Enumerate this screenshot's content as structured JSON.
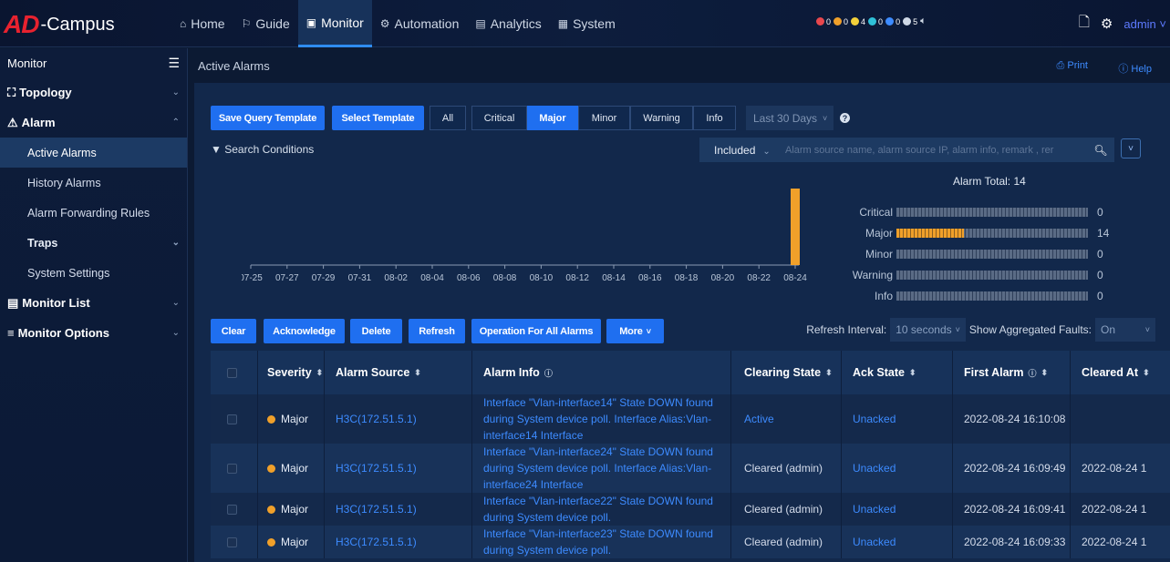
{
  "brand": {
    "logo_mark": "AD",
    "logo_text": "-Campus"
  },
  "nav": [
    {
      "label": "Home",
      "icon": "home-icon"
    },
    {
      "label": "Guide",
      "icon": "guide-icon"
    },
    {
      "label": "Monitor",
      "icon": "monitor-icon",
      "active": true
    },
    {
      "label": "Automation",
      "icon": "automation-icon"
    },
    {
      "label": "Analytics",
      "icon": "analytics-icon"
    },
    {
      "label": "System",
      "icon": "system-icon"
    }
  ],
  "alarm_counts": [
    {
      "value": "0",
      "color": "#e8474d"
    },
    {
      "value": "0",
      "color": "#f0a02a"
    },
    {
      "value": "4",
      "color": "#f3d03a"
    },
    {
      "value": "0",
      "color": "#2fc1d8"
    },
    {
      "value": "0",
      "color": "#3d8bff"
    },
    {
      "value": "5",
      "color": "#cfd8e6"
    }
  ],
  "user": {
    "name": "admin"
  },
  "sidebar": {
    "title": "Monitor",
    "topology": "Topology",
    "alarm": "Alarm",
    "active_alarms": "Active Alarms",
    "history_alarms": "History Alarms",
    "alarm_forwarding": "Alarm Forwarding Rules",
    "traps": "Traps",
    "system_settings": "System Settings",
    "monitor_list": "Monitor List",
    "monitor_options": "Monitor Options"
  },
  "page": {
    "breadcrumb": "Active Alarms",
    "print": "Print",
    "help": "Help"
  },
  "toolbar": {
    "save_query_template": "Save Query Template",
    "select_template": "Select Template",
    "filters": [
      "All",
      "Critical",
      "Major",
      "Minor",
      "Warning",
      "Info"
    ],
    "selected_filter": "Major",
    "date_range": "Last 30 Days"
  },
  "search": {
    "conditions_label": "Search Conditions",
    "scope": "Included",
    "placeholder": "Alarm source name, alarm source IP, alarm info, remark , rer"
  },
  "chart_data": {
    "type": "bar",
    "categories": [
      "07-25",
      "07-27",
      "07-29",
      "07-31",
      "08-02",
      "08-04",
      "08-06",
      "08-08",
      "08-10",
      "08-12",
      "08-14",
      "08-16",
      "08-18",
      "08-20",
      "08-22",
      "08-24"
    ],
    "values": [
      0,
      0,
      0,
      0,
      0,
      0,
      0,
      0,
      0,
      0,
      0,
      0,
      0,
      0,
      0,
      14
    ],
    "bar_color": "#f0a02a"
  },
  "summary": {
    "total_label": "Alarm Total:",
    "total": "14",
    "rows": [
      {
        "label": "Critical",
        "value": "0",
        "fraction": 0
      },
      {
        "label": "Major",
        "value": "14",
        "fraction": 0.35
      },
      {
        "label": "Minor",
        "value": "0",
        "fraction": 0
      },
      {
        "label": "Warning",
        "value": "0",
        "fraction": 0
      },
      {
        "label": "Info",
        "value": "0",
        "fraction": 0
      }
    ]
  },
  "actions": {
    "clear": "Clear",
    "acknowledge": "Acknowledge",
    "delete": "Delete",
    "refresh": "Refresh",
    "operation_all": "Operation For All Alarms",
    "more": "More"
  },
  "refresh": {
    "interval_label": "Refresh Interval:",
    "interval_value": "10 seconds",
    "aggregated_label": "Show Aggregated Faults:",
    "aggregated_value": "On"
  },
  "table": {
    "headers": [
      "Severity",
      "Alarm Source",
      "Alarm Info",
      "Clearing State",
      "Ack State",
      "First Alarm",
      "Cleared At"
    ],
    "rows": [
      {
        "severity": "Major",
        "source": "H3C(172.51.5.1)",
        "info": "Interface \"Vlan-interface14\" State DOWN found during System device poll. Interface Alias:Vlan-interface14 Interface",
        "clearing": "Active",
        "ack": "Unacked",
        "first": "2022-08-24 16:10:08",
        "cleared": ""
      },
      {
        "severity": "Major",
        "source": "H3C(172.51.5.1)",
        "info": "Interface \"Vlan-interface24\" State DOWN found during System device poll. Interface Alias:Vlan-interface24 Interface",
        "clearing": "Cleared (admin)",
        "ack": "Unacked",
        "first": "2022-08-24 16:09:49",
        "cleared": "2022-08-24 1"
      },
      {
        "severity": "Major",
        "source": "H3C(172.51.5.1)",
        "info": "Interface \"Vlan-interface22\" State DOWN found during System device poll.",
        "clearing": "Cleared (admin)",
        "ack": "Unacked",
        "first": "2022-08-24 16:09:41",
        "cleared": "2022-08-24 1"
      },
      {
        "severity": "Major",
        "source": "H3C(172.51.5.1)",
        "info": "Interface \"Vlan-interface23\" State DOWN found during System device poll.",
        "clearing": "Cleared (admin)",
        "ack": "Unacked",
        "first": "2022-08-24 16:09:33",
        "cleared": "2022-08-24 1"
      }
    ]
  }
}
